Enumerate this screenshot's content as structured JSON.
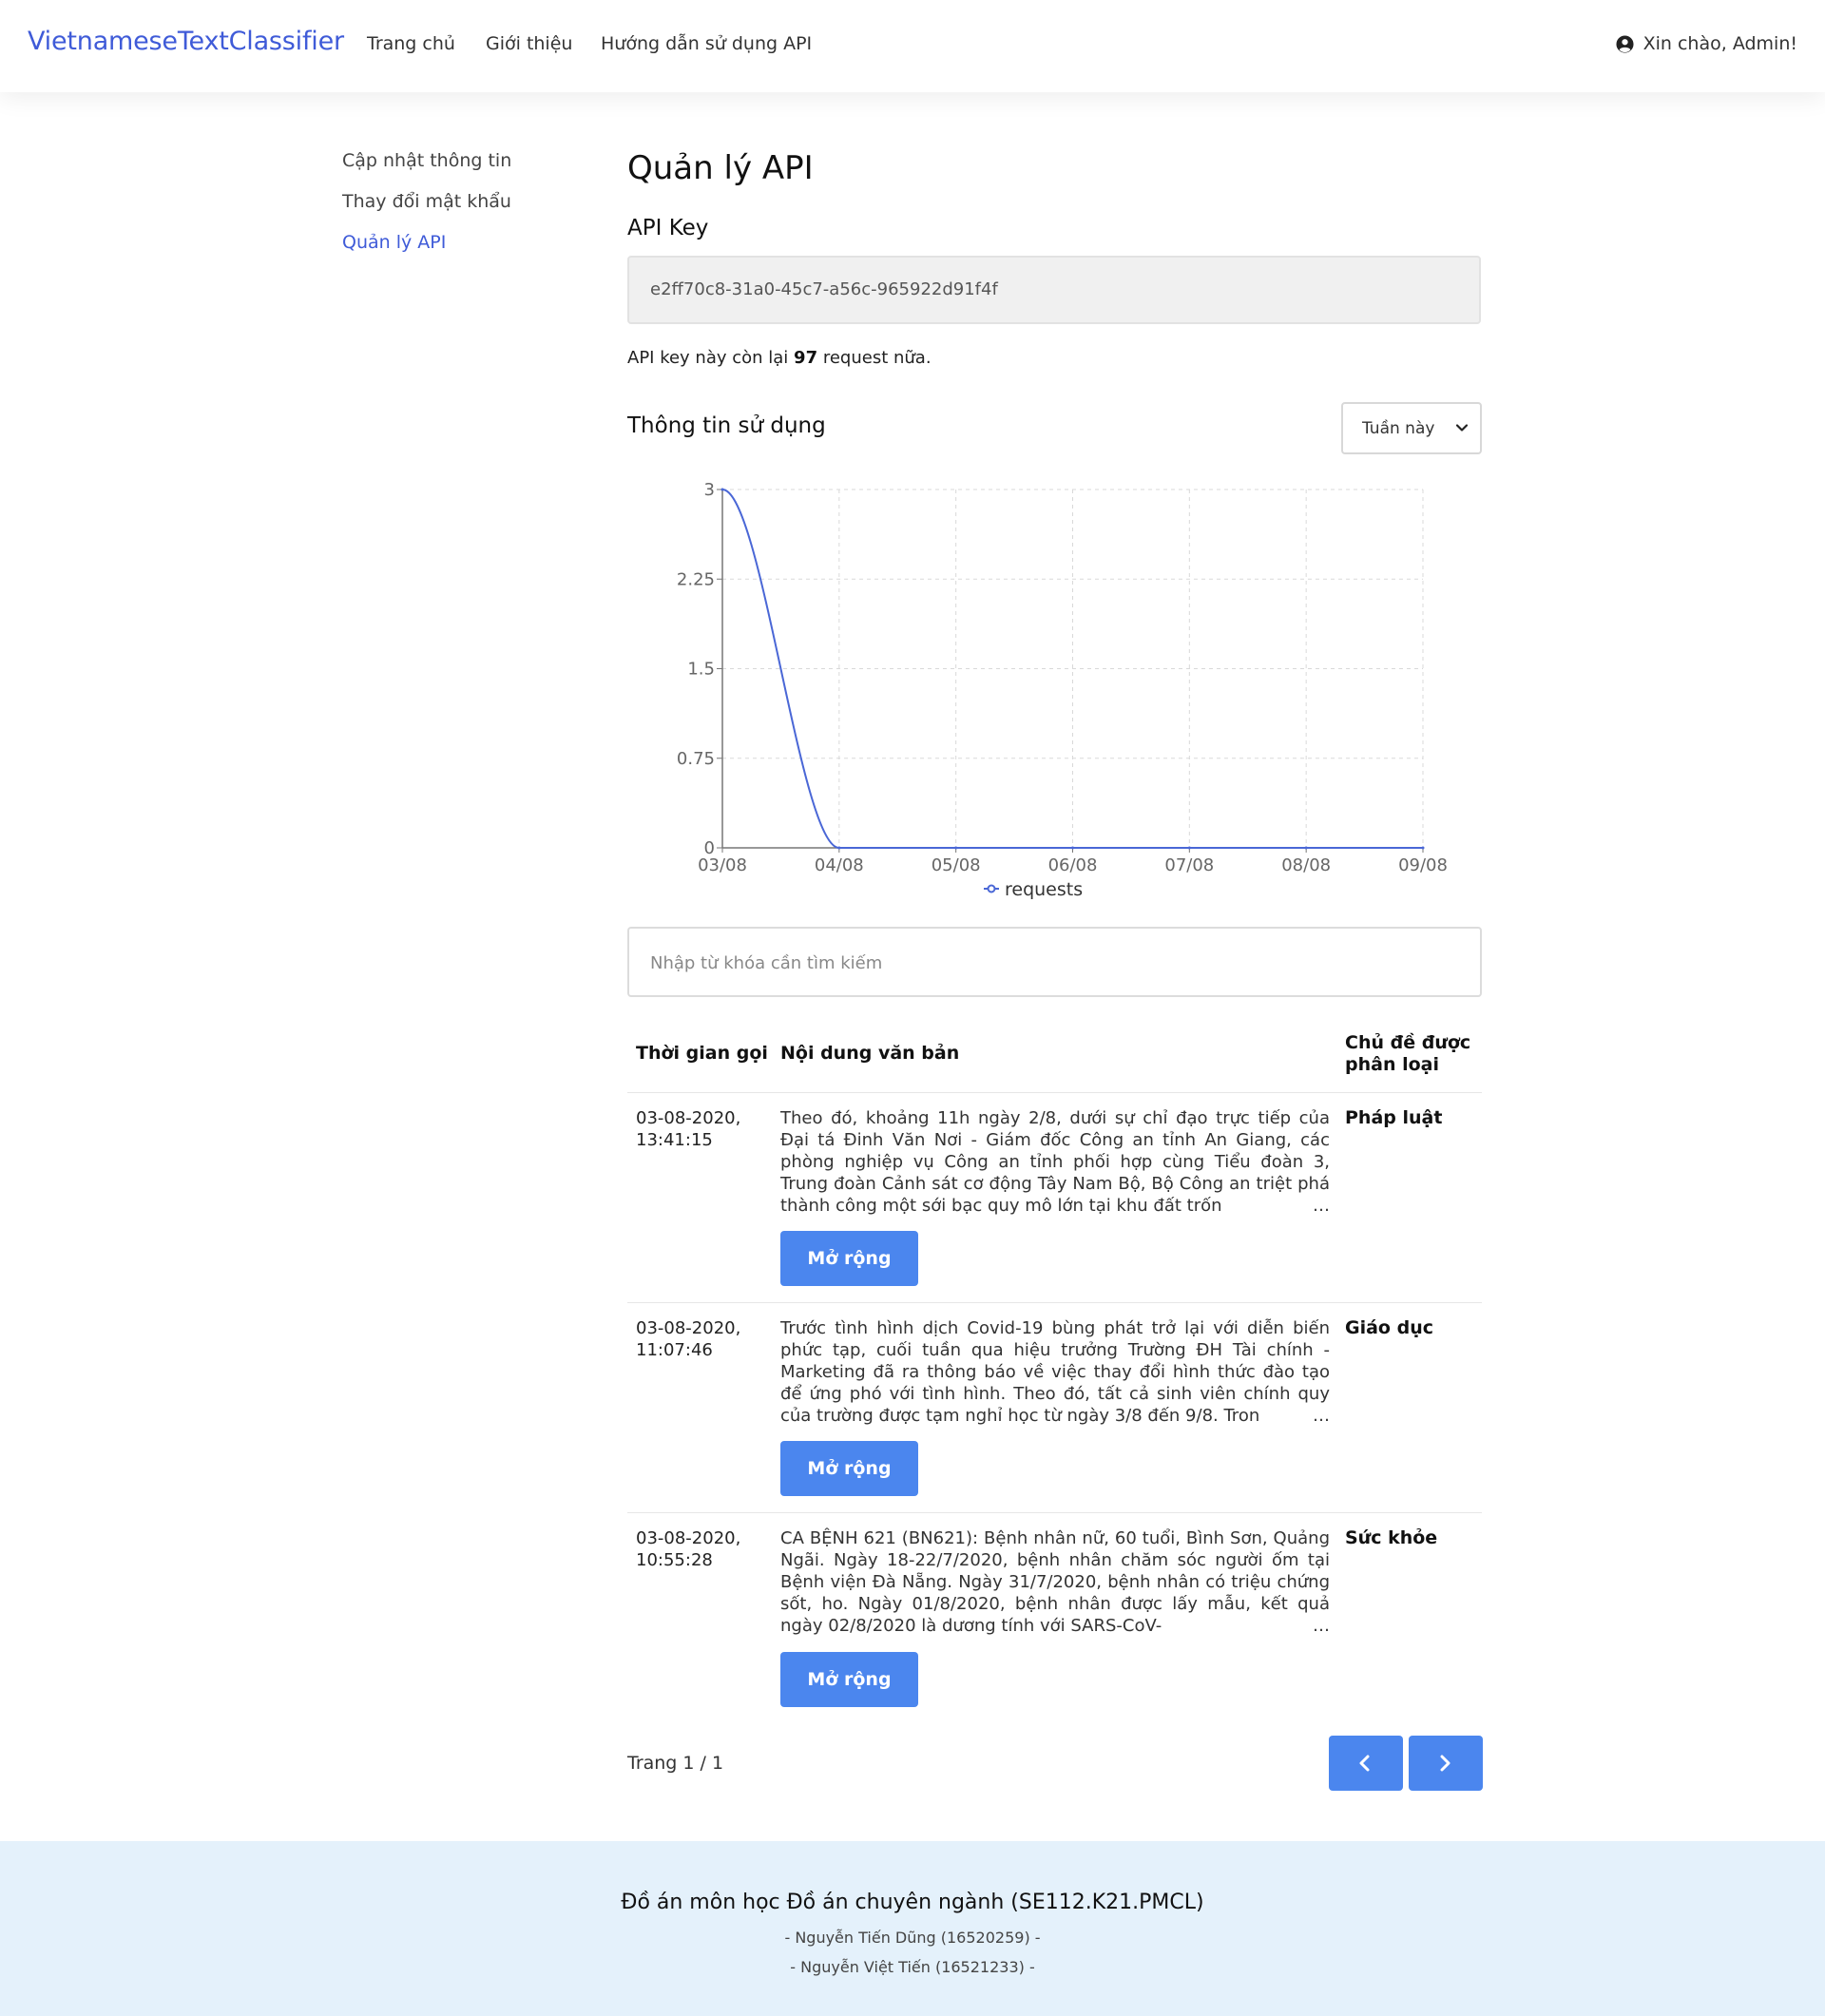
{
  "header": {
    "brand": "VietnameseTextClassifier",
    "nav": [
      "Trang chủ",
      "Giới thiệu",
      "Hướng dẫn sử dụng API"
    ],
    "greeting": "Xin chào, Admin!",
    "user_icon": "user-circle-icon"
  },
  "sidebar": {
    "items": [
      {
        "label": "Cập nhật thông tin",
        "active": false
      },
      {
        "label": "Thay đổi mật khẩu",
        "active": false
      },
      {
        "label": "Quản lý API",
        "active": true
      }
    ]
  },
  "main": {
    "title": "Quản lý API",
    "api_key_heading": "API Key",
    "api_key": "e2ff70c8-31a0-45c7-a56c-965922d91f4f",
    "remaining_prefix": "API key này còn lại ",
    "remaining_count": "97",
    "remaining_suffix": " request nữa.",
    "usage_heading": "Thông tin sử dụng",
    "period_selected": "Tuần này"
  },
  "chart_data": {
    "type": "line",
    "categories": [
      "03/08",
      "04/08",
      "05/08",
      "06/08",
      "07/08",
      "08/08",
      "09/08"
    ],
    "series": [
      {
        "name": "requests",
        "values": [
          3,
          0,
          0,
          0,
          0,
          0,
          0
        ]
      }
    ],
    "y_ticks": [
      "0",
      "0.75",
      "1.5",
      "2.25",
      "3"
    ],
    "ylim": [
      0,
      3
    ],
    "grid": true,
    "legend_position": "bottom",
    "line_color": "#4a67d6"
  },
  "search": {
    "placeholder": "Nhập từ khóa cần tìm kiếm",
    "value": ""
  },
  "table": {
    "headers": [
      "Thời gian gọi",
      "Nội dung văn bản",
      "Chủ đề được phân loại"
    ],
    "expand_label": "Mở rộng",
    "rows": [
      {
        "time": "03-08-2020, 13:41:15",
        "text": "Theo đó, khoảng 11h ngày 2/8, dưới sự chỉ đạo trực tiếp của Đại tá Đinh Văn Nơi - Giám đốc Công an tỉnh An Giang, các phòng nghiệp vụ Công an tỉnh phối hợp cùng Tiểu đoàn 3, Trung đoàn Cảnh sát cơ động Tây Nam Bộ, Bộ Công an triệt phá thành công một sới bạc quy mô lớn tại khu đất trốn",
        "topic": "Pháp luật"
      },
      {
        "time": "03-08-2020, 11:07:46",
        "text": "Trước tình hình dịch Covid-19 bùng phát trở lại với diễn biến phức tạp, cuối tuần qua hiệu trưởng Trường ĐH Tài chính - Marketing đã ra thông báo về việc thay đổi hình thức đào tạo để ứng phó với tình hình. Theo đó, tất cả sinh viên chính quy của trường được tạm nghỉ học từ ngày 3/8 đến 9/8. Tron",
        "topic": "Giáo dục"
      },
      {
        "time": "03-08-2020, 10:55:28",
        "text": "CA BỆNH 621 (BN621): Bệnh nhân nữ, 60 tuổi, Bình Sơn, Quảng Ngãi. Ngày 18-22/7/2020, bệnh nhân chăm sóc người ốm tại Bệnh viện Đà Nẵng. Ngày 31/7/2020, bệnh nhân có triệu chứng sốt, ho. Ngày 01/8/2020, bệnh nhân được lấy mẫu, kết quả ngày 02/8/2020 là dương tính với SARS-CoV-",
        "topic": "Sức khỏe"
      }
    ]
  },
  "pagination": {
    "label": "Trang 1 / 1",
    "prev_icon": "chevron-left-icon",
    "next_icon": "chevron-right-icon"
  },
  "footer": {
    "title": "Đồ án môn học Đồ án chuyên ngành (SE112.K21.PMCL)",
    "members": [
      "- Nguyễn Tiến Dũng (16520259) -",
      "- Nguyễn Việt Tiến (16521233) -"
    ]
  },
  "colors": {
    "accent": "#3f5bd8",
    "button": "#4b86ee",
    "footer_bg": "#e4f1fb"
  }
}
